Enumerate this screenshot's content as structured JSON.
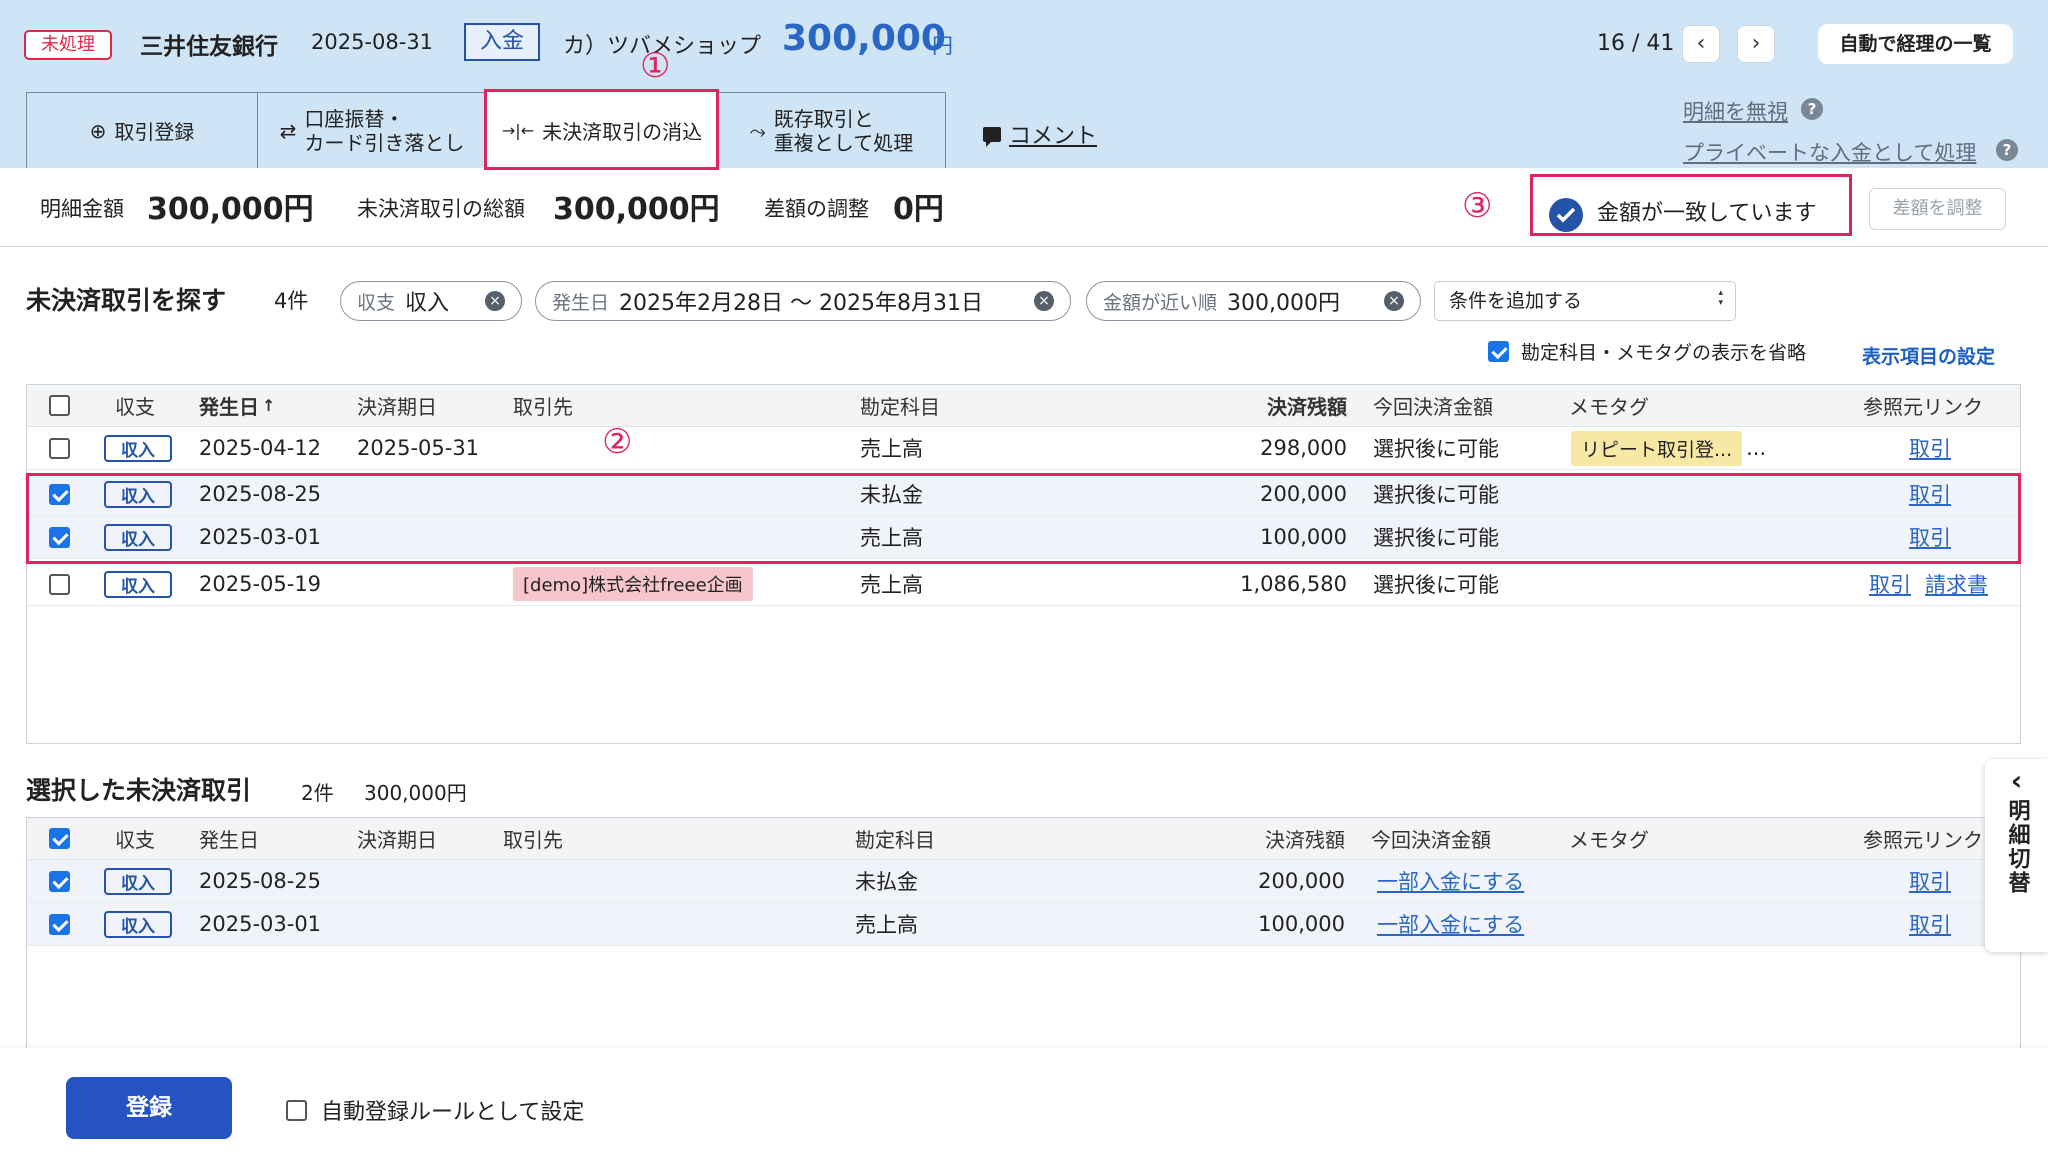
{
  "header": {
    "status": "未処理",
    "bank": "三井住友銀行",
    "date": "2025-08-31",
    "kind": "入金",
    "partner": "カ）ツバメショップ",
    "amount": "300,000",
    "yen": "円",
    "pager": "16 / 41",
    "prev": "‹",
    "next": "›",
    "auto_list": "自動で経理の一覧"
  },
  "annotations": {
    "a1": "①",
    "a2": "②",
    "a3": "③"
  },
  "tabs": [
    {
      "icon": "⊕",
      "label": "取引登録"
    },
    {
      "icon": "⇄",
      "label1": "口座振替・",
      "label2": "カード引き落とし"
    },
    {
      "icon": "→|←",
      "label": "未決済取引の消込"
    },
    {
      "icon": "⤳",
      "label1": "既存取引と",
      "label2": "重複として処理"
    }
  ],
  "comment": "コメント",
  "links": {
    "ignore": "明細を無視",
    "private": "プライベートな入金として処理",
    "help": "?"
  },
  "summary": {
    "detail_label": "明細金額",
    "detail_value": "300,000円",
    "total_label": "未決済取引の総額",
    "total_value": "300,000円",
    "diff_label": "差額の調整",
    "diff_value": "0円",
    "match_text": "金額が一致しています",
    "adjust_button": "差額を調整"
  },
  "search": {
    "title": "未決済取引を探す",
    "count": "4件",
    "chips": [
      {
        "key": "収支",
        "value": "収入"
      },
      {
        "key": "発生日",
        "value": "2025年2月28日 〜 2025年8月31日"
      },
      {
        "key": "金額が近い順",
        "value": "300,000円"
      }
    ],
    "chip_close": "×",
    "add_condition": "条件を追加する",
    "omit_label": "勘定科目・メモタグの表示を省略",
    "settings": "表示項目の設定"
  },
  "table_headers": {
    "type": "収支",
    "date": "発生日",
    "sort": "↑",
    "due": "決済期日",
    "partner": "取引先",
    "account": "勘定科目",
    "balance": "決済残額",
    "current": "今回決済金額",
    "memo": "メモタグ",
    "ref": "参照元リンク"
  },
  "search_rows": [
    {
      "type": "収入",
      "date": "2025-04-12",
      "due": "2025-05-31",
      "partner": "",
      "account": "売上高",
      "balance": "298,000",
      "current": "選択後に可能",
      "memo": "リピート取引登...",
      "memo_more": "...",
      "ref": "取引",
      "ref2": ""
    },
    {
      "type": "収入",
      "date": "2025-08-25",
      "due": "",
      "partner": "",
      "account": "未払金",
      "balance": "200,000",
      "current": "選択後に可能",
      "memo": "",
      "ref": "取引",
      "ref2": ""
    },
    {
      "type": "収入",
      "date": "2025-03-01",
      "due": "",
      "partner": "",
      "account": "売上高",
      "balance": "100,000",
      "current": "選択後に可能",
      "memo": "",
      "ref": "取引",
      "ref2": ""
    },
    {
      "type": "収入",
      "date": "2025-05-19",
      "due": "",
      "partner": "[demo]株式会社freee企画",
      "account": "売上高",
      "balance": "1,086,580",
      "current": "選択後に可能",
      "memo": "",
      "ref": "取引",
      "ref2": "請求書"
    }
  ],
  "selected": {
    "title": "選択した未決済取引",
    "count": "2件",
    "total": "300,000円",
    "rows": [
      {
        "type": "収入",
        "date": "2025-08-25",
        "account": "未払金",
        "balance": "200,000",
        "partial": "一部入金にする",
        "ref": "取引"
      },
      {
        "type": "収入",
        "date": "2025-03-01",
        "account": "売上高",
        "balance": "100,000",
        "partial": "一部入金にする",
        "ref": "取引"
      }
    ]
  },
  "footer": {
    "register": "登録",
    "auto_rule": "自動登録ルールとして設定"
  },
  "side_toggle": {
    "arrow": "‹",
    "label": "明細切替"
  }
}
